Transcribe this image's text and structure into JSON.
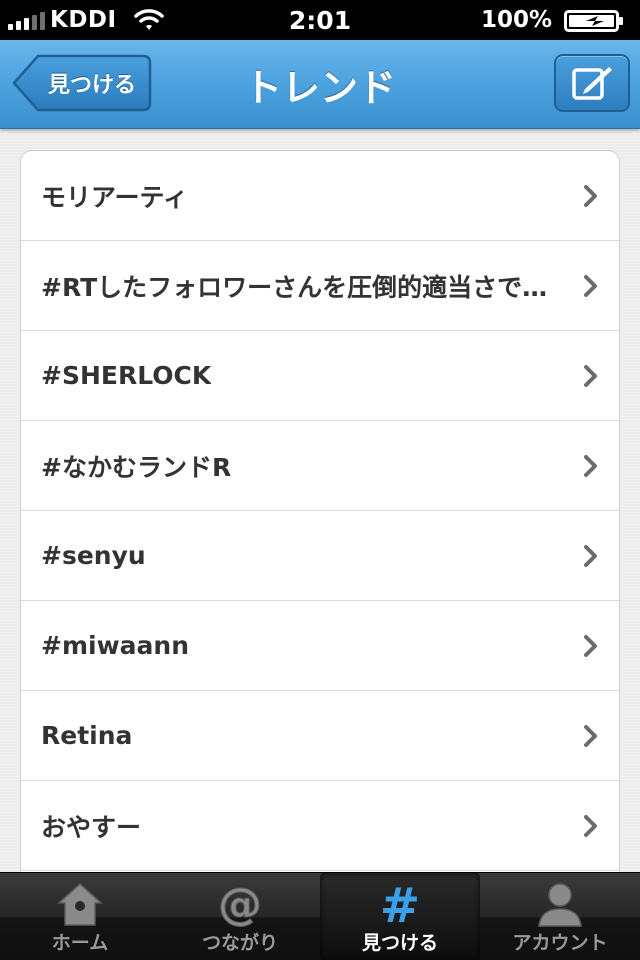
{
  "status_bar": {
    "carrier": "KDDI",
    "time": "2:01",
    "battery": "100%"
  },
  "nav": {
    "back_label": "見つける",
    "title": "トレンド"
  },
  "trends": [
    {
      "label": "モリアーティ"
    },
    {
      "label": "#RTしたフォロワーさんを圧倒的適当さで紹介"
    },
    {
      "label": "#SHERLOCK"
    },
    {
      "label": "#なかむランドR"
    },
    {
      "label": "#senyu"
    },
    {
      "label": "#miwaann"
    },
    {
      "label": "Retina"
    },
    {
      "label": "おやすー"
    }
  ],
  "tabs": [
    {
      "label": "ホーム",
      "icon": "home-icon",
      "selected": false
    },
    {
      "label": "つながり",
      "icon": "at-icon",
      "selected": false
    },
    {
      "label": "見つける",
      "icon": "hash-icon",
      "selected": true
    },
    {
      "label": "アカウント",
      "icon": "person-icon",
      "selected": false
    }
  ],
  "colors": {
    "nav_blue": "#4ea4e0",
    "selected_tab_icon": "#3aa0ea"
  }
}
